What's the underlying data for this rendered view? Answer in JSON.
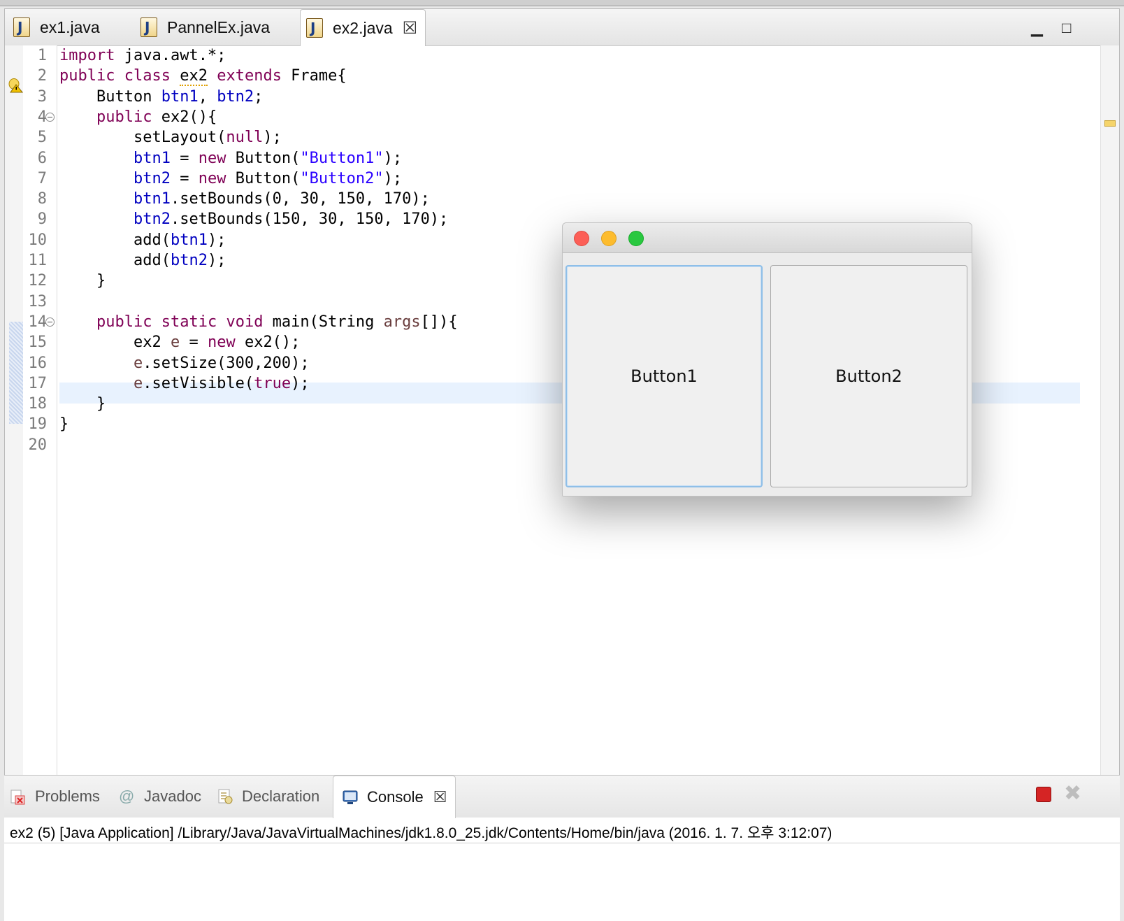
{
  "editor": {
    "tabs": [
      {
        "label": "ex1.java"
      },
      {
        "label": "PannelEx.java"
      },
      {
        "label": "ex2.java",
        "active": true
      }
    ],
    "line_numbers": [
      "1",
      "2",
      "3",
      "4",
      "5",
      "6",
      "7",
      "8",
      "9",
      "10",
      "11",
      "12",
      "13",
      "14",
      "15",
      "16",
      "17",
      "18",
      "19",
      "20"
    ],
    "current_line": 17
  },
  "bottom_panel": {
    "tabs": [
      {
        "label": "Problems"
      },
      {
        "label": "Javadoc"
      },
      {
        "label": "Declaration"
      },
      {
        "label": "Console",
        "active": true
      }
    ],
    "console_header": "ex2 (5) [Java Application] /Library/Java/JavaVirtualMachines/jdk1.8.0_25.jdk/Contents/Home/bin/java (2016. 1. 7. 오후 3:12:07)"
  },
  "awt_window": {
    "button1_label": "Button1",
    "button2_label": "Button2"
  },
  "colors": {
    "keyword": "#7f0055",
    "field": "#0000c0",
    "string": "#2a00ff",
    "current_line_bg": "#e8f2fe"
  }
}
